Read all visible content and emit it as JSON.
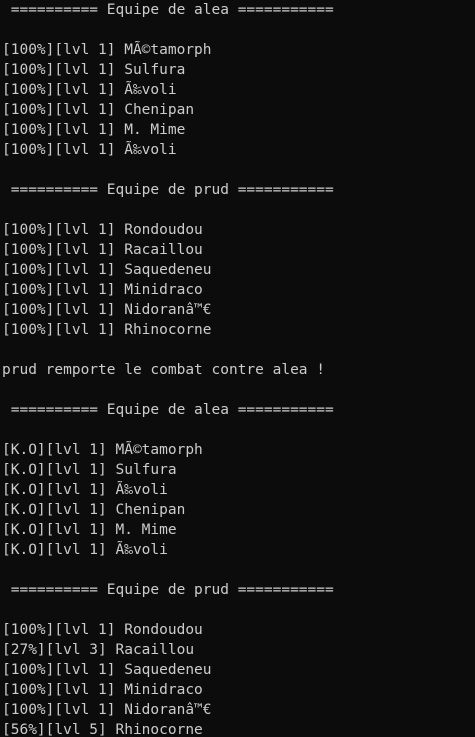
{
  "console": {
    "lines": [
      " ========== Equipe de alea ===========",
      "",
      "[100%][lvl 1] MÃ©tamorph",
      "[100%][lvl 1] Sulfura",
      "[100%][lvl 1] Ã‰voli",
      "[100%][lvl 1] Chenipan",
      "[100%][lvl 1] M. Mime",
      "[100%][lvl 1] Ã‰voli",
      "",
      " ========== Equipe de prud ===========",
      "",
      "[100%][lvl 1] Rondoudou",
      "[100%][lvl 1] Racaillou",
      "[100%][lvl 1] Saquedeneu",
      "[100%][lvl 1] Minidraco",
      "[100%][lvl 1] Nidoranâ™€",
      "[100%][lvl 1] Rhinocorne",
      "",
      "prud remporte le combat contre alea !",
      "",
      " ========== Equipe de alea ===========",
      "",
      "[K.O][lvl 1] MÃ©tamorph",
      "[K.O][lvl 1] Sulfura",
      "[K.O][lvl 1] Ã‰voli",
      "[K.O][lvl 1] Chenipan",
      "[K.O][lvl 1] M. Mime",
      "[K.O][lvl 1] Ã‰voli",
      "",
      " ========== Equipe de prud ===========",
      "",
      "[100%][lvl 1] Rondoudou",
      "[27%][lvl 3] Racaillou",
      "[100%][lvl 1] Saquedeneu",
      "[100%][lvl 1] Minidraco",
      "[100%][lvl 1] Nidoranâ™€",
      "[56%][lvl 5] Rhinocorne"
    ]
  }
}
